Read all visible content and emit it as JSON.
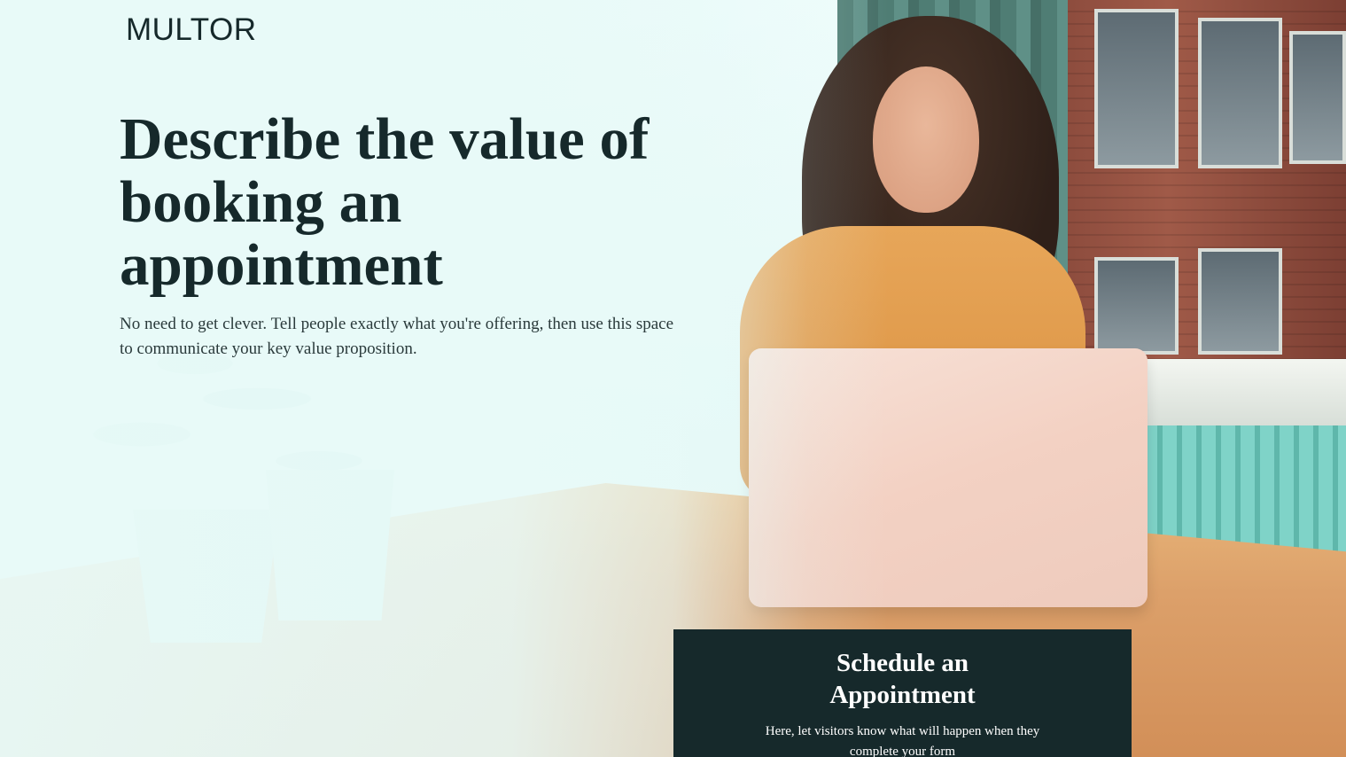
{
  "brand": {
    "logo_text": "MULTOR"
  },
  "hero": {
    "headline": "Describe the value of booking an appointment",
    "subtext": "No need to get clever. Tell people exactly what you're offering, then use this space to communicate your key value proposition."
  },
  "form": {
    "title": "Schedule an Appointment",
    "description": "Here, let visitors know what will happen when they complete your form"
  },
  "colors": {
    "primary_dark": "#16292b",
    "background_mint": "#eafaf8",
    "text_on_dark": "#ffffff"
  }
}
